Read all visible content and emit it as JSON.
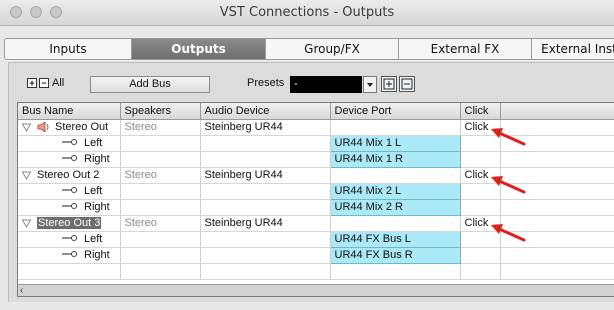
{
  "window": {
    "title": "VST Connections - Outputs"
  },
  "tabs": [
    {
      "label": "Inputs",
      "active": false
    },
    {
      "label": "Outputs",
      "active": true
    },
    {
      "label": "Group/FX",
      "active": false
    },
    {
      "label": "External FX",
      "active": false
    },
    {
      "label": "External Instr",
      "active": false
    }
  ],
  "toolbar": {
    "expand_icon": "plus-box-icon",
    "collapse_icon": "minus-box-icon",
    "all_label": "All",
    "add_bus_label": "Add Bus",
    "presets_label": "Presets",
    "presets_value": "-",
    "store_preset_icon": "store-preset-icon",
    "delete_preset_icon": "delete-preset-icon"
  },
  "table": {
    "columns": [
      "Bus Name",
      "Speakers",
      "Audio Device",
      "Device Port",
      "Click"
    ],
    "rows": [
      {
        "type": "bus",
        "name": "Stereo Out",
        "speakers": "Stereo",
        "device": "Steinberg UR44",
        "port": "",
        "click": "Click",
        "speaker_icon": true,
        "selected": false
      },
      {
        "type": "channel",
        "name": "Left",
        "speakers": "",
        "device": "",
        "port": "UR44 Mix 1 L",
        "click": ""
      },
      {
        "type": "channel",
        "name": "Right",
        "speakers": "",
        "device": "",
        "port": "UR44 Mix 1 R",
        "click": ""
      },
      {
        "type": "bus",
        "name": "Stereo Out 2",
        "speakers": "Stereo",
        "device": "Steinberg UR44",
        "port": "",
        "click": "Click",
        "speaker_icon": false,
        "selected": false
      },
      {
        "type": "channel",
        "name": "Left",
        "speakers": "",
        "device": "",
        "port": "UR44 Mix 2 L",
        "click": ""
      },
      {
        "type": "channel",
        "name": "Right",
        "speakers": "",
        "device": "",
        "port": "UR44 Mix 2 R",
        "click": ""
      },
      {
        "type": "bus",
        "name": "Stereo Out 3",
        "speakers": "Stereo",
        "device": "Steinberg UR44",
        "port": "",
        "click": "Click",
        "speaker_icon": false,
        "selected": true
      },
      {
        "type": "channel",
        "name": "Left",
        "speakers": "",
        "device": "",
        "port": "UR44 FX Bus L",
        "click": ""
      },
      {
        "type": "channel",
        "name": "Right",
        "speakers": "",
        "device": "",
        "port": "UR44 FX Bus R",
        "click": ""
      },
      {
        "type": "empty",
        "name": "",
        "speakers": "",
        "device": "",
        "port": "",
        "click": ""
      }
    ]
  },
  "colors": {
    "port_fill": "#aae9f5",
    "annotation_arrow": "#e0201b",
    "active_tab": "#7a7a7a"
  }
}
